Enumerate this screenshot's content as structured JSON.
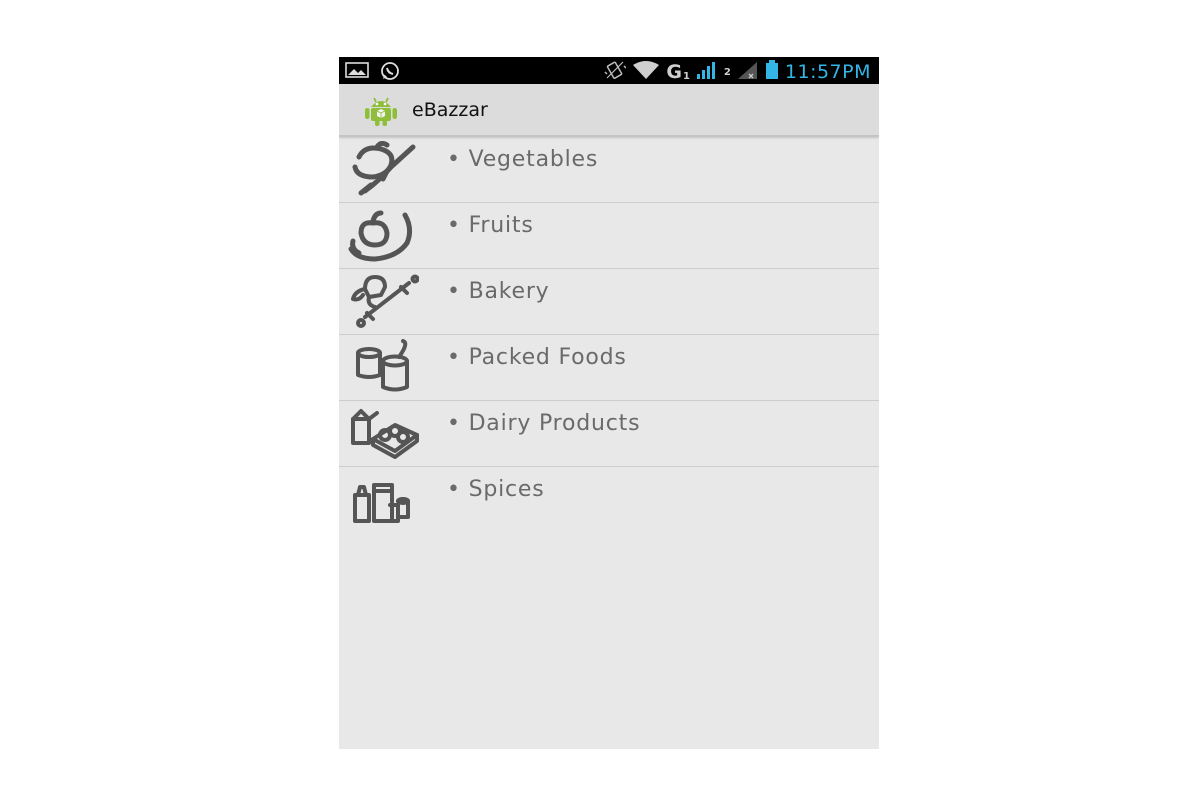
{
  "status_bar": {
    "time": "11:57PM",
    "network_type": "G",
    "sim1": "1",
    "sim2": "2",
    "icons": [
      "gallery-notification-icon",
      "whatsapp-notification-icon",
      "vibrate-icon",
      "wifi-icon",
      "signal-sim1-icon",
      "signal-sim2-icon",
      "battery-icon"
    ],
    "accent_color": "#33b5e5"
  },
  "action_bar": {
    "app_icon": "android-icon",
    "title": "eBazzar"
  },
  "categories": [
    {
      "label": "• Vegetables",
      "icon": "vegetables-icon"
    },
    {
      "label": "• Fruits",
      "icon": "fruits-icon"
    },
    {
      "label": "• Bakery",
      "icon": "bakery-icon"
    },
    {
      "label": "• Packed Foods",
      "icon": "packed-foods-icon"
    },
    {
      "label": "• Dairy Products",
      "icon": "dairy-products-icon"
    },
    {
      "label": "• Spices",
      "icon": "spices-icon"
    }
  ]
}
